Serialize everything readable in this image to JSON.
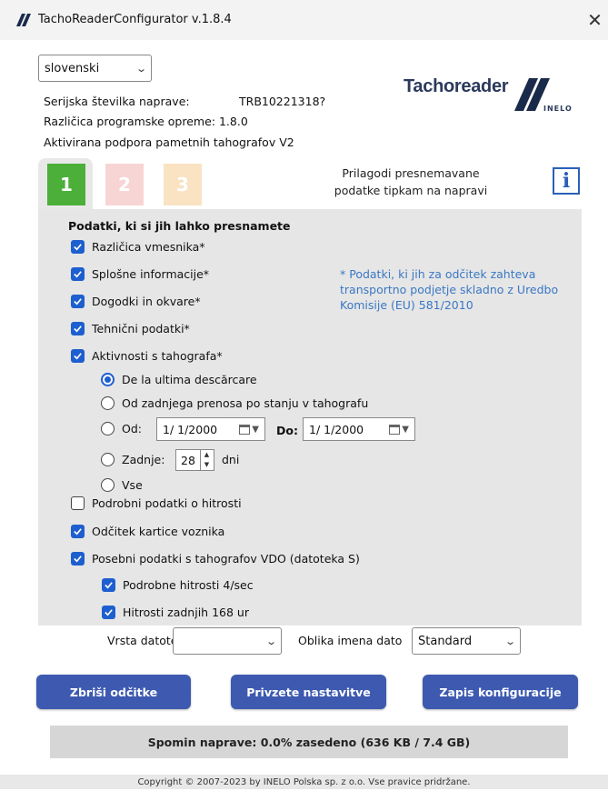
{
  "window": {
    "title": "TachoReaderConfigurator v.1.8.4",
    "close_label": "✕"
  },
  "language": {
    "selected": "slovenski"
  },
  "device_info": {
    "serial_label": "Serijska številka naprave:",
    "serial_value": "TRB10221318?",
    "firmware_label": "Različica programske opreme:",
    "firmware_value": "1.8.0",
    "smart_support": "Aktivirana podpora pametnih tahografov V2"
  },
  "logo": {
    "name": "Tachoreader",
    "sub": "INELO"
  },
  "tabs": [
    {
      "label": "1",
      "color": "#4caf3a",
      "active": true
    },
    {
      "label": "2",
      "color": "#f7d5d4",
      "active": false
    },
    {
      "label": "3",
      "color": "#f9e3c3",
      "active": false
    }
  ],
  "tab_hint": {
    "line1": "Prilagodi presnemavane",
    "line2": "podatke tipkam na napravi"
  },
  "info_button": {
    "icon": "info-icon",
    "label": "i"
  },
  "data_section": {
    "heading": "Podatki, ki si jih lahko presnamete",
    "items": [
      {
        "label": "Različica vmesnika*",
        "checked": true
      },
      {
        "label": "Splošne informacije*",
        "checked": true
      },
      {
        "label": "Dogodki in okvare*",
        "checked": true
      },
      {
        "label": "Tehnični podatki*",
        "checked": true
      },
      {
        "label": "Aktivnosti s tahografa*",
        "checked": true
      }
    ],
    "note": "* Podatki, ki jih za odčitek zahteva transportno podjetje skladno z Uredbo Komisije (EU) 581/2010",
    "activity_options": {
      "since_last": "De la ultima descărcare",
      "from_last_transfer": "Od zadnjega prenosa po stanju v tahografu",
      "from_label": "Od:",
      "from_date": "1/ 1/2000",
      "to_label": "Do:",
      "to_date": "1/ 1/2000",
      "last_label": "Zadnje:",
      "last_days": "28",
      "days_unit": "dni",
      "all": "Vse",
      "selected": "since_last"
    },
    "extra": [
      {
        "label": "Podrobni podatki o hitrosti",
        "checked": false
      },
      {
        "label": "Odčitek kartice voznika",
        "checked": true
      },
      {
        "label": "Posebni podatki s tahografov VDO (datoteka S)",
        "checked": true
      }
    ],
    "vdo_sub": [
      {
        "label": "Podrobne hitrosti 4/sec",
        "checked": true
      },
      {
        "label": "Hitrosti zadnjih 168 ur",
        "checked": true
      }
    ]
  },
  "file_type": {
    "label": "Vrsta datoteke",
    "value": ""
  },
  "name_format": {
    "label": "Oblika imena dato",
    "value": "Standard"
  },
  "buttons": {
    "delete": "Zbriši odčitke",
    "defaults": "Privzete nastavitve",
    "write": "Zapis konfiguracije"
  },
  "memory": "Spomin naprave: 0.0% zasedeno (636 KB / 7.4 GB)",
  "footer": "Copyright © 2007-2023 by INELO Polska sp. z o.o. Vse pravice pridržane."
}
